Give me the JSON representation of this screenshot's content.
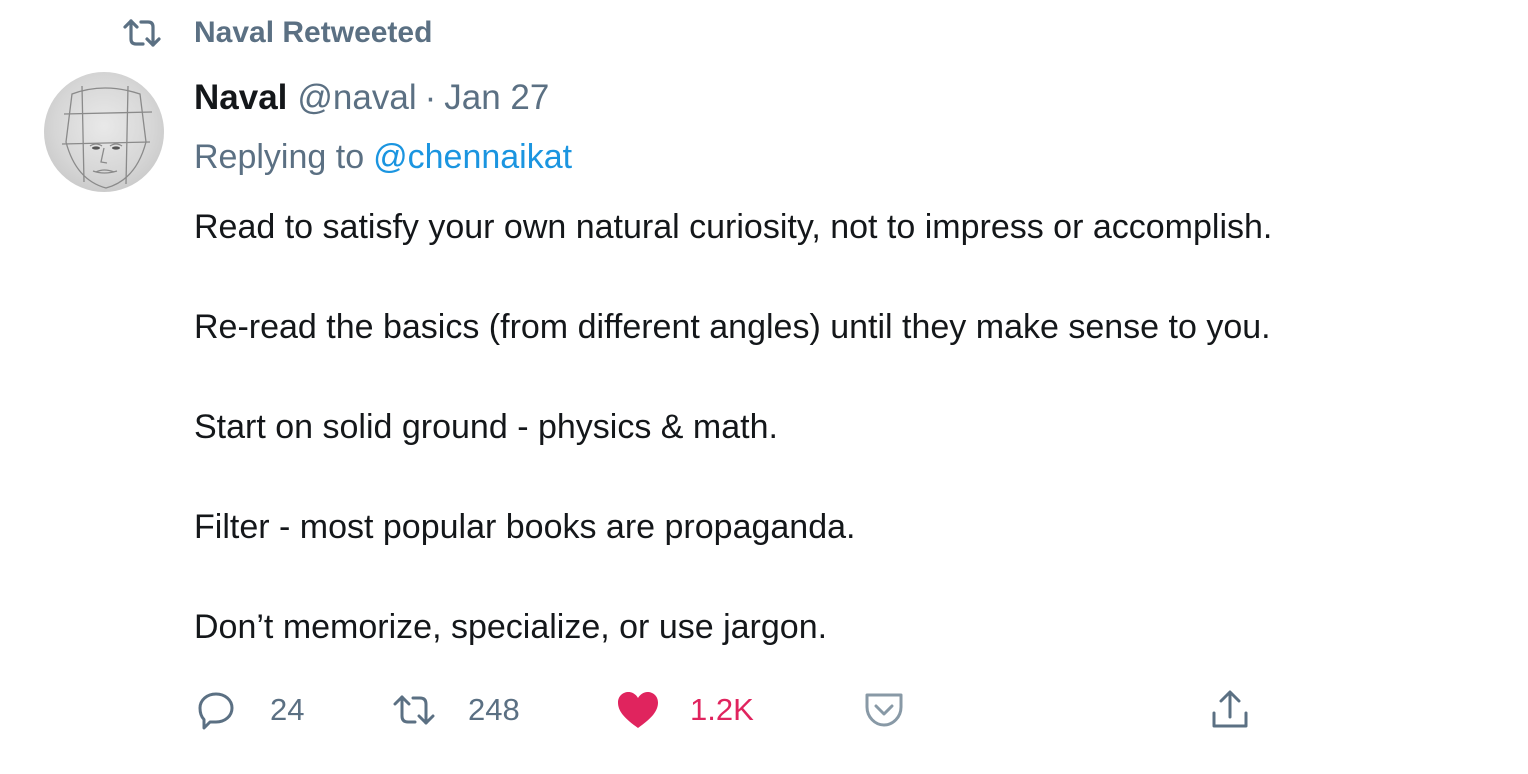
{
  "retweet_banner": {
    "icon": "retweet-icon",
    "text": "Naval Retweeted"
  },
  "tweet": {
    "avatar": "avatar-sketch-face",
    "display_name": "Naval",
    "handle": "@naval",
    "separator": "·",
    "date": "Jan 27",
    "reply_prefix": "Replying to",
    "reply_mention": "@chennaikat",
    "paragraphs": [
      "Read to satisfy your own natural curiosity, not to impress or accomplish.",
      "Re-read the basics (from different angles) until they make sense to you.",
      "Start on solid ground - physics & math.",
      "Filter - most popular books are propaganda.",
      "Don’t memorize, specialize, or use jargon."
    ]
  },
  "actions": {
    "reply": {
      "icon": "reply-icon",
      "count": "24"
    },
    "retweet": {
      "icon": "retweet-icon",
      "count": "248"
    },
    "like": {
      "icon": "heart-icon",
      "count": "1.2K",
      "liked": true
    },
    "pocket": {
      "icon": "pocket-icon"
    },
    "share": {
      "icon": "share-icon"
    }
  },
  "colors": {
    "secondary_text": "#5b7083",
    "link": "#1b95e0",
    "like": "#e0245e",
    "primary_text": "#14171a"
  }
}
